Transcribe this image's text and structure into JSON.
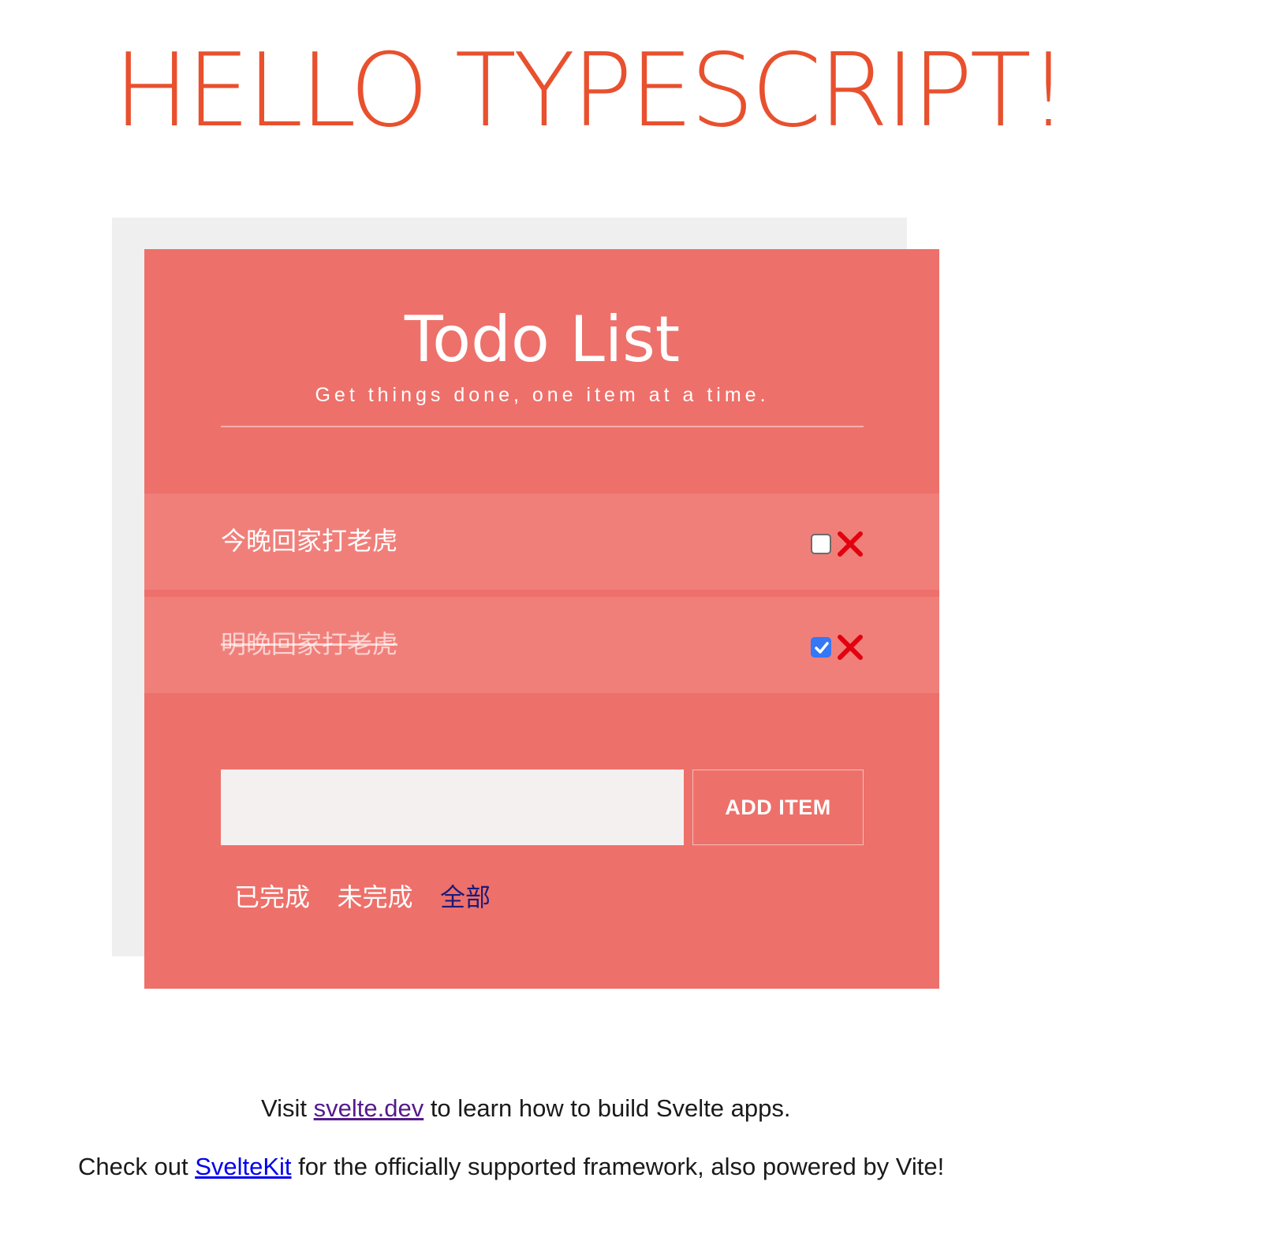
{
  "page": {
    "hero_title": "Hello Typescript!"
  },
  "todo": {
    "title": "Todo List",
    "subtitle": "Get things done, one item at a time.",
    "items": [
      {
        "text": "今晚回家打老虎",
        "completed": false
      },
      {
        "text": "明晚回家打老虎",
        "completed": true
      }
    ],
    "input": {
      "value": "",
      "placeholder": ""
    },
    "add_button_label": "ADD ITEM",
    "filters": [
      {
        "label": "已完成",
        "active": false
      },
      {
        "label": "未完成",
        "active": false
      },
      {
        "label": "全部",
        "active": true
      }
    ]
  },
  "footer": {
    "line1": {
      "prefix": "Visit ",
      "link": "svelte.dev",
      "suffix": " to learn how to build Svelte apps."
    },
    "line2": {
      "prefix": "Check out ",
      "link": "SvelteKit",
      "suffix": " for the officially supported framework, also powered by Vite!"
    }
  },
  "colors": {
    "hero": "#e8502e",
    "card": "#ee706a",
    "item": "#f07f7a",
    "back_panel": "#efefef",
    "delete": "#e3000f",
    "active_filter": "#1c1a7a",
    "checkbox_checked": "#3478f6"
  },
  "icons": {
    "delete": "close-icon",
    "check": "checkmark-icon"
  }
}
